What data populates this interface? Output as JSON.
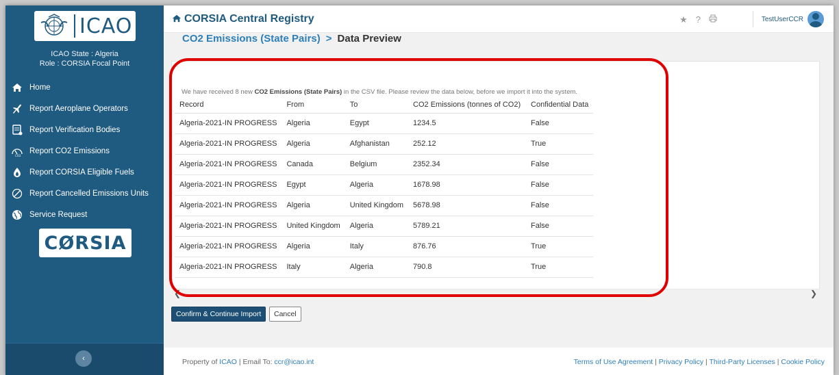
{
  "sidebar": {
    "logo_text": "ICAO",
    "state_line": "ICAO State : Algeria",
    "role_line": "Role : CORSIA Focal Point",
    "menu": [
      {
        "label": "Home",
        "icon": "home-icon"
      },
      {
        "label": "Report Aeroplane Operators",
        "icon": "plane-icon"
      },
      {
        "label": "Report Verification Bodies",
        "icon": "document-icon"
      },
      {
        "label": "Report CO2 Emissions",
        "icon": "co2-gauge-icon"
      },
      {
        "label": "Report CORSIA Eligible Fuels",
        "icon": "fuel-drop-icon"
      },
      {
        "label": "Report Cancelled Emissions Units",
        "icon": "cancel-circle-icon"
      },
      {
        "label": "Service Request",
        "icon": "globe-icon"
      }
    ],
    "corsia_logo": "CØRSIA"
  },
  "header": {
    "title": "CORSIA Central Registry",
    "user": "TestUserCCR"
  },
  "breadcrumb": {
    "parent": "CO2 Emissions (State Pairs)",
    "separator": ">",
    "current": "Data Preview"
  },
  "notice": {
    "before": "We have received 8 new ",
    "bold": "CO2 Emissions (State Pairs)",
    "after": " in the CSV file. Please review the data below, before we import it into the system."
  },
  "table": {
    "columns": [
      "Record",
      "From",
      "To",
      "CO2 Emissions (tonnes of CO2)",
      "Confidential Data"
    ],
    "rows": [
      [
        "Algeria-2021-IN PROGRESS",
        "Algeria",
        "Egypt",
        "1234.5",
        "False"
      ],
      [
        "Algeria-2021-IN PROGRESS",
        "Algeria",
        "Afghanistan",
        "252.12",
        "True"
      ],
      [
        "Algeria-2021-IN PROGRESS",
        "Canada",
        "Belgium",
        "2352.34",
        "False"
      ],
      [
        "Algeria-2021-IN PROGRESS",
        "Egypt",
        "Algeria",
        "1678.98",
        "False"
      ],
      [
        "Algeria-2021-IN PROGRESS",
        "Algeria",
        "United Kingdom",
        "5678.98",
        "False"
      ],
      [
        "Algeria-2021-IN PROGRESS",
        "United Kingdom",
        "Algeria",
        "5789.21",
        "False"
      ],
      [
        "Algeria-2021-IN PROGRESS",
        "Algeria",
        "Italy",
        "876.76",
        "True"
      ],
      [
        "Algeria-2021-IN PROGRESS",
        "Italy",
        "Algeria",
        "790.8",
        "True"
      ]
    ]
  },
  "buttons": {
    "confirm": "Confirm & Continue Import",
    "cancel": "Cancel"
  },
  "footer": {
    "property_prefix": "Property of ",
    "property_link": "ICAO",
    "email_prefix": " | Email To: ",
    "email": "ccr@icao.int",
    "links": [
      "Terms of Use Agreement",
      "Privacy Policy",
      "Third-Party Licenses",
      "Cookie Policy"
    ]
  },
  "colors": {
    "sidebar": "#1f5a80",
    "accent": "#2e7fb8",
    "highlight": "#e00000"
  }
}
